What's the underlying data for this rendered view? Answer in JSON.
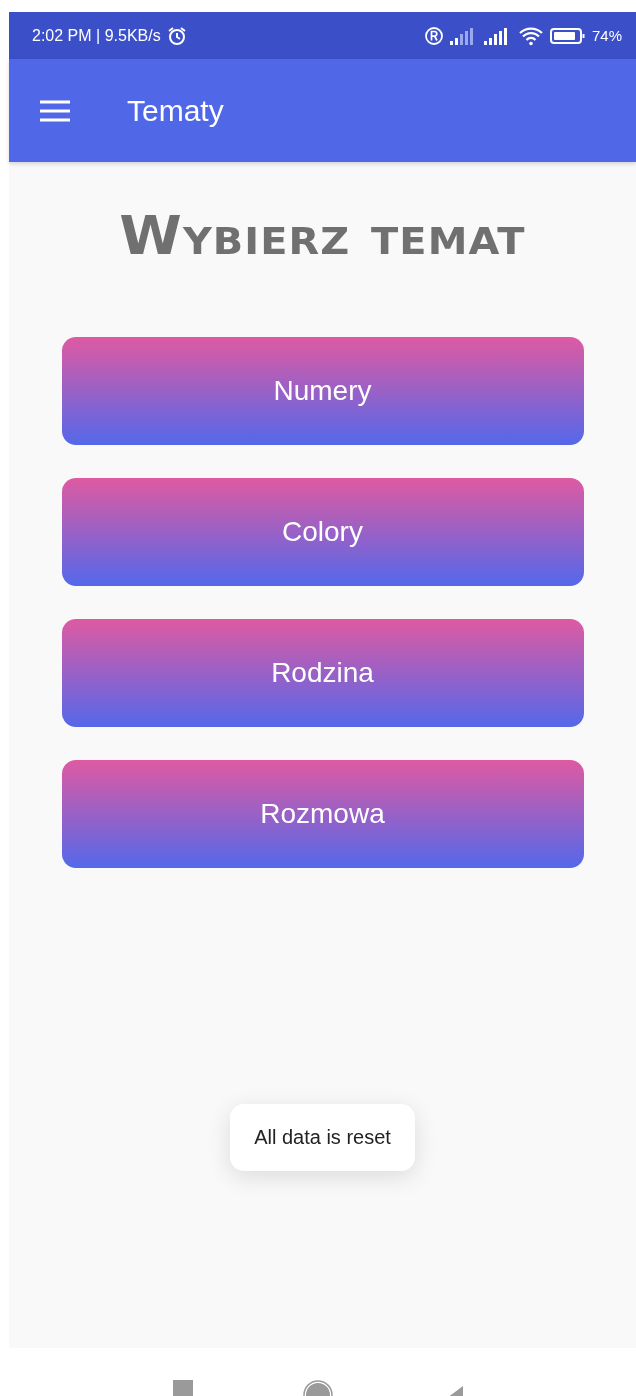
{
  "status_bar": {
    "time": "2:02 PM | 9.5KB/s",
    "battery": "74%"
  },
  "app_bar": {
    "title": "Tematy"
  },
  "heading": "Wybierz temat",
  "topics": [
    {
      "label": "Numery"
    },
    {
      "label": "Colory"
    },
    {
      "label": "Rodzina"
    },
    {
      "label": "Rozmowa"
    }
  ],
  "toast": "All data is reset"
}
